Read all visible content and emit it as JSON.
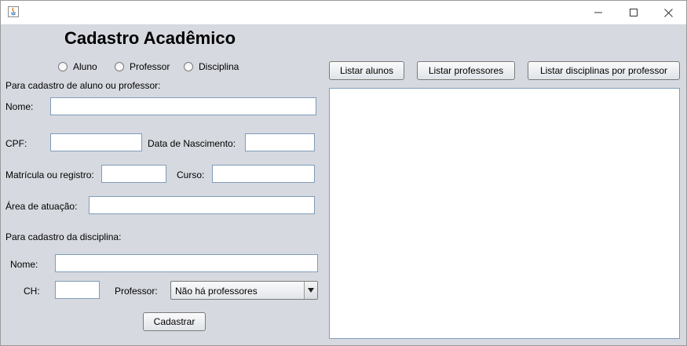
{
  "window": {
    "title": ""
  },
  "header": {
    "title": "Cadastro Acadêmico"
  },
  "radios": [
    {
      "label": "Aluno"
    },
    {
      "label": "Professor"
    },
    {
      "label": "Disciplina"
    }
  ],
  "person_section": {
    "heading": "Para cadastro de aluno ou professor:",
    "name_label": "Nome:",
    "name_value": "",
    "cpf_label": "CPF:",
    "cpf_value": "",
    "birth_label": "Data de Nascimento:",
    "birth_value": "",
    "registration_label": "Matrícula ou registro:",
    "registration_value": "",
    "course_label": "Curso:",
    "course_value": "",
    "area_label": "Área de atuação:",
    "area_value": ""
  },
  "discipline_section": {
    "heading": "Para cadastro da disciplina:",
    "name_label": "Nome:",
    "name_value": "",
    "ch_label": "CH:",
    "ch_value": "",
    "professor_label": "Professor:",
    "professor_selected": "Não há professores"
  },
  "actions": {
    "register_label": "Cadastrar"
  },
  "list_buttons": {
    "students": "Listar alunos",
    "professors": "Listar professores",
    "disciplines": "Listar disciplinas por professor"
  },
  "icons": {
    "app": "java-icon",
    "minimize": "minimize-icon",
    "maximize": "maximize-icon",
    "close": "close-icon",
    "dropdown": "chevron-down-icon"
  }
}
